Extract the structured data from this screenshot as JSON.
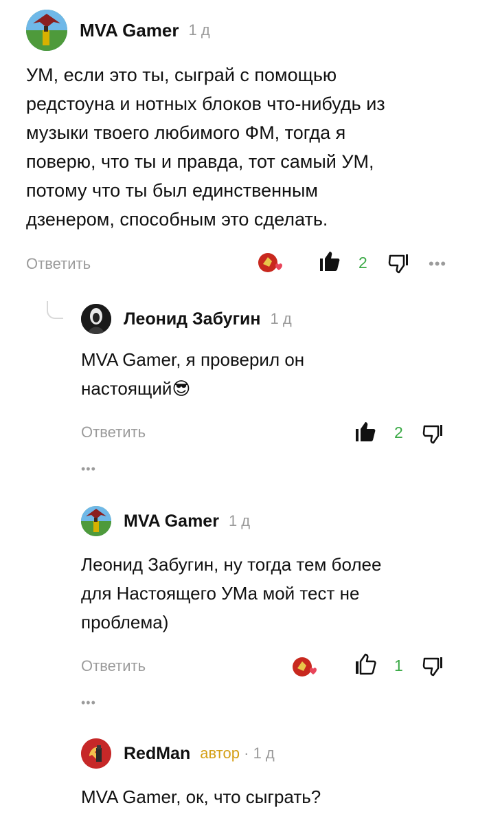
{
  "comments": [
    {
      "author": "MVA Gamer",
      "time": "1 д",
      "text_lines": [
        "УМ, если это ты, сыграй с помощью",
        "редстоуна и нотных блоков что-нибудь из",
        "музыки твоего любимого ФМ, тогда я",
        "поверю, что ты и правда, тот самый УМ,",
        "потому что ты был единственным",
        "дзенером, способным это сделать."
      ],
      "reply_label": "Ответить",
      "likes": "2",
      "more_label": "•••"
    },
    {
      "author": "Леонид Забугин",
      "time": "1 д",
      "text_lines": [
        "MVA Gamer, я проверил он",
        "настоящий"
      ],
      "emoji": "😎",
      "reply_label": "Ответить",
      "likes": "2",
      "more_label": "•••"
    },
    {
      "author": "MVA Gamer",
      "time": "1 д",
      "text_lines": [
        "Леонид Забугин, ну тогда тем более",
        "для Настоящего УМа мой тест не",
        "проблема)"
      ],
      "reply_label": "Ответить",
      "likes": "1",
      "more_label": "•••"
    },
    {
      "author": "RedMan",
      "badge": "автор",
      "separator": "·",
      "time": "1 д",
      "text_lines": [
        "MVA Gamer, ок, что сыграть?"
      ]
    }
  ],
  "colors": {
    "like_green": "#3aa945",
    "muted_gray": "#9b9b9b",
    "author_badge": "#d4a017"
  }
}
